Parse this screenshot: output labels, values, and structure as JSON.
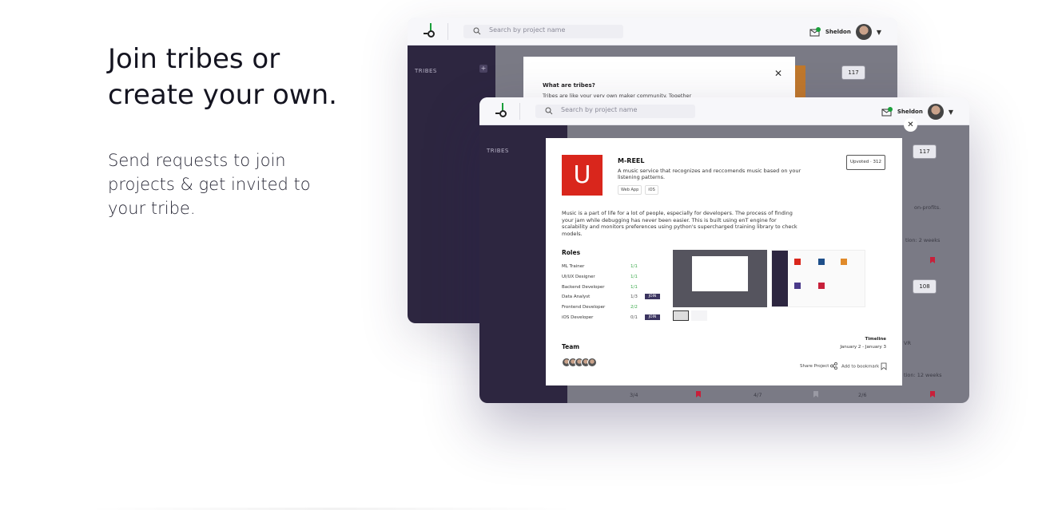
{
  "hero": {
    "title": "Join tribes or create your own.",
    "subtitle": "Send requests to join projects & get invited to your tribe."
  },
  "app": {
    "search_placeholder": "Search by project name",
    "user_name": "Sheldon",
    "sidebar_label": "TRIBES"
  },
  "tribes_modal": {
    "title": "What are tribes?",
    "text": "Tribes are like your very own maker community. Together"
  },
  "background_cards": {
    "upvote_top": "117",
    "upvote_mid": "108",
    "snippet_nonprofits": "on-profits.",
    "snippet_duration_1": "tion:  2 weeks",
    "snippet_vr": "VR",
    "snippet_duration_2": "tion:  12 weeks",
    "bottom_counts": [
      "3/4",
      "4/7",
      "2/6"
    ]
  },
  "project": {
    "logo_letter": "U",
    "name": "M-REEL",
    "description": "A music service that recognizes and reccomends music based on your listening patterns.",
    "tags": [
      "Web App",
      "iOS"
    ],
    "upvoted_label": "Upvoted · 312",
    "long_description": "Music is a part of life for a lot of people, especially for developers. The process of finding your jam while debugging has never been easier. This is built using enT engine for scalability and monitors preferences using python's supercharged training library to check models.",
    "roles_title": "Roles",
    "roles": [
      {
        "name": "ML Trainer",
        "count": "1/1",
        "join": ""
      },
      {
        "name": "UI/UX Designer",
        "count": "1/1",
        "join": ""
      },
      {
        "name": "Backend Developer",
        "count": "1/1",
        "join": ""
      },
      {
        "name": "Data Analyst",
        "count": "1/3",
        "join": "JOIN"
      },
      {
        "name": "Frontend Developer",
        "count": "2/2",
        "join": ""
      },
      {
        "name": "iOS Developer",
        "count": "0/1",
        "join": "JOIN"
      }
    ],
    "timeline_label": "Timeline",
    "timeline_value": "January 2 - January 3",
    "team_title": "Team",
    "share_label": "Share Project",
    "bookmark_label": "Add to bookmark"
  },
  "colors": {
    "sidebar": "#2d2640",
    "logo_red": "#d9261c",
    "join": "#3b3460",
    "green": "#3aa84a"
  }
}
